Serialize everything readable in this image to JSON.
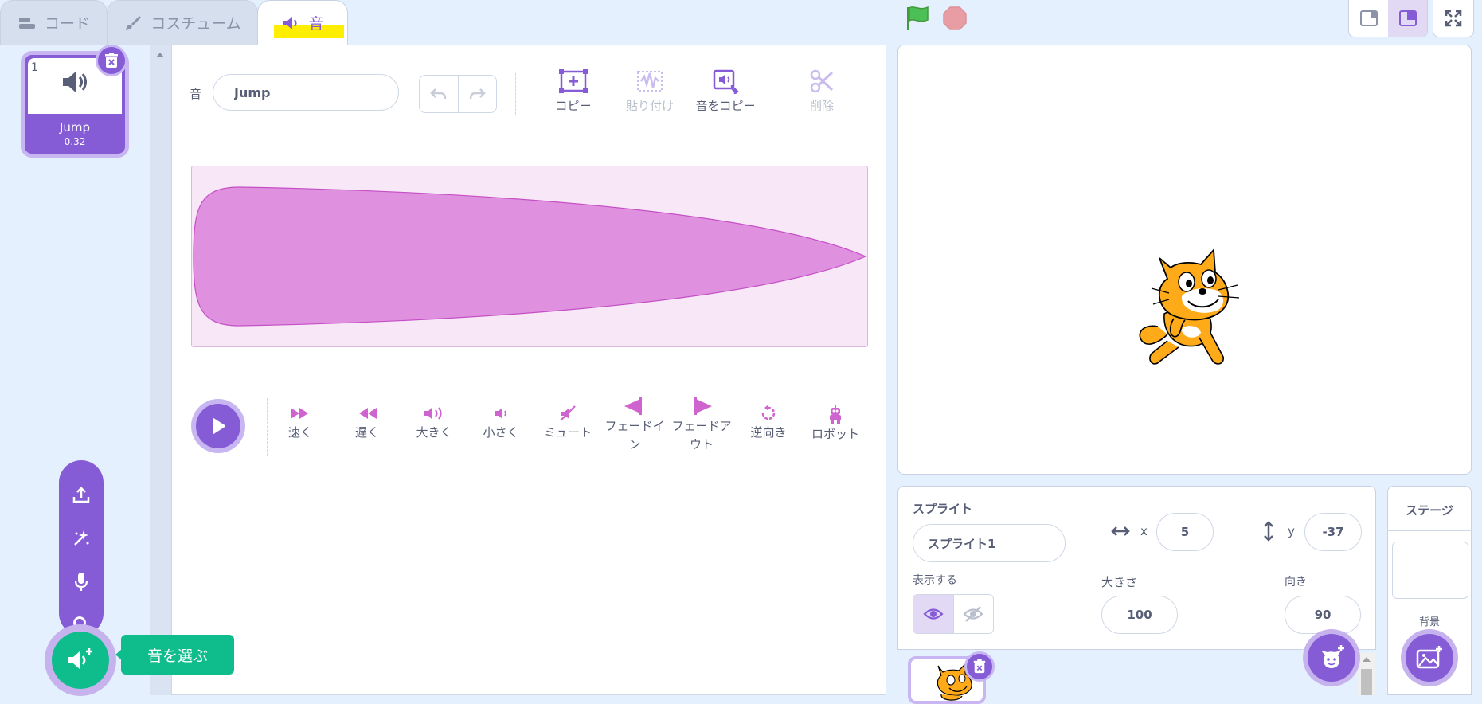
{
  "tabs": [
    {
      "label": "コード",
      "icon": "code-blocks-icon"
    },
    {
      "label": "コスチューム",
      "icon": "paintbrush-icon"
    },
    {
      "label": "音",
      "icon": "speaker-icon",
      "active": true
    }
  ],
  "sound_list": {
    "items": [
      {
        "index": "1",
        "name": "Jump",
        "duration": "0.32",
        "icon": "speaker-icon"
      }
    ]
  },
  "editor": {
    "name_label": "音",
    "name_value": "Jump",
    "tools": [
      {
        "label": "コピー",
        "icon": "copy-icon",
        "enabled": true
      },
      {
        "label": "貼り付け",
        "icon": "paste-icon",
        "enabled": false
      },
      {
        "label": "音をコピー",
        "icon": "copy-to-new-icon",
        "enabled": true
      },
      {
        "label": "削除",
        "icon": "scissors-icon",
        "enabled": false
      }
    ],
    "effects": [
      {
        "label": "速く",
        "icon": "faster-icon"
      },
      {
        "label": "遅く",
        "icon": "slower-icon"
      },
      {
        "label": "大きく",
        "icon": "louder-icon"
      },
      {
        "label": "小さく",
        "icon": "softer-icon"
      },
      {
        "label": "ミュート",
        "icon": "mute-icon"
      },
      {
        "label": "フェードイン",
        "icon": "fade-in-icon"
      },
      {
        "label": "フェードアウト",
        "icon": "fade-out-icon"
      },
      {
        "label": "逆向き",
        "icon": "reverse-icon"
      },
      {
        "label": "ロボット",
        "icon": "robot-icon"
      }
    ]
  },
  "add_sound": {
    "tooltip": "音を選ぶ",
    "menu": [
      "upload-icon",
      "surprise-icon",
      "microphone-icon",
      "search-icon"
    ]
  },
  "sprite_info": {
    "sprite_label": "スプライト",
    "sprite_name": "スプライト1",
    "x_label": "x",
    "x": "5",
    "y_label": "y",
    "y": "-37",
    "show_label": "表示する",
    "size_label": "大きさ",
    "size": "100",
    "direction_label": "向き",
    "direction": "90"
  },
  "stage_panel": {
    "title": "ステージ",
    "backdrop_label": "背景"
  },
  "colors": {
    "accent": "#855cd6",
    "accent_light": "#c8b6f2",
    "sound": "#cf63cf",
    "extension_green": "#0fbd8c",
    "background": "#e5f0ff"
  }
}
